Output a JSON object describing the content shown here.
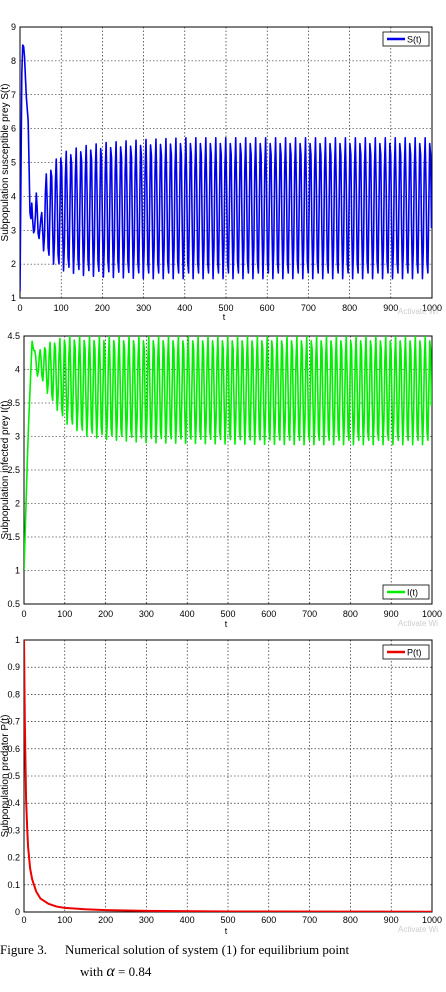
{
  "chart_data": [
    {
      "type": "line",
      "xlabel": "t",
      "ylabel": "Subpopulation susceptible prey S(t)",
      "xlim": [
        0,
        1000
      ],
      "ylim": [
        1,
        9
      ],
      "xticks": [
        0,
        100,
        200,
        300,
        400,
        500,
        600,
        700,
        800,
        900,
        1000
      ],
      "yticks": [
        1,
        2,
        3,
        4,
        5,
        6,
        7,
        8,
        9
      ],
      "grid": true,
      "legend_position": "top-right",
      "color": "#0000ee",
      "series": [
        {
          "name": "S(t)",
          "x": [
            0,
            5,
            10,
            15,
            20,
            25,
            30,
            35,
            40,
            50,
            60,
            80,
            100,
            150,
            200,
            300,
            400,
            500,
            700,
            1000
          ],
          "y": [
            1.2,
            8.5,
            8.4,
            7.0,
            6.2,
            3.0,
            4.3,
            3.0,
            4.2,
            3.3,
            4.6,
            5.0,
            5.3,
            5.5,
            5.6,
            5.7,
            5.75,
            5.75,
            5.75,
            5.75
          ],
          "y_low": [
            1.2,
            8.5,
            8.4,
            7.0,
            6.2,
            3.0,
            2.8,
            3.0,
            2.9,
            2.6,
            2.3,
            2.0,
            1.8,
            1.65,
            1.6,
            1.55,
            1.55,
            1.55,
            1.55,
            1.55
          ]
        }
      ]
    },
    {
      "type": "line",
      "xlabel": "t",
      "ylabel": "Subpopulation infected prey I(t)",
      "xlim": [
        0,
        1000
      ],
      "ylim": [
        0.5,
        4.5
      ],
      "xticks": [
        0,
        100,
        200,
        300,
        400,
        500,
        600,
        700,
        800,
        900,
        1000
      ],
      "yticks": [
        0.5,
        1,
        1.5,
        2,
        2.5,
        3,
        3.5,
        4,
        4.5
      ],
      "grid": true,
      "legend_position": "bottom-right",
      "color": "#00ee00",
      "series": [
        {
          "name": "I(t)",
          "x": [
            0,
            5,
            10,
            20,
            30,
            40,
            60,
            80,
            100,
            150,
            200,
            300,
            500,
            700,
            1000
          ],
          "y": [
            1.0,
            2.0,
            3.0,
            4.45,
            4.2,
            4.3,
            4.4,
            4.45,
            4.5,
            4.5,
            4.5,
            4.5,
            4.5,
            4.5,
            4.5
          ],
          "y_low": [
            1.0,
            2.0,
            3.0,
            4.45,
            3.9,
            3.9,
            3.6,
            3.4,
            3.2,
            3.0,
            2.95,
            2.9,
            2.88,
            2.87,
            2.87
          ]
        }
      ]
    },
    {
      "type": "line",
      "xlabel": "t",
      "ylabel": "Subpopulation predator P(t)",
      "xlim": [
        0,
        1000
      ],
      "ylim": [
        0,
        1
      ],
      "xticks": [
        0,
        100,
        200,
        300,
        400,
        500,
        600,
        700,
        800,
        900,
        1000
      ],
      "yticks": [
        0,
        0.1,
        0.2,
        0.3,
        0.4,
        0.5,
        0.6,
        0.7,
        0.8,
        0.9,
        1
      ],
      "ytick_labels": [
        "0",
        "0.1",
        "0.2",
        "0.3",
        "0.4",
        "0.5",
        "0.6",
        "0.7",
        "0.8",
        "0.9",
        "1"
      ],
      "grid": true,
      "legend_position": "top-right",
      "color": "#ee0000",
      "series": [
        {
          "name": "P(t)",
          "x": [
            0,
            2,
            5,
            8,
            10,
            15,
            20,
            30,
            40,
            60,
            80,
            100,
            150,
            200,
            300,
            500,
            1000
          ],
          "y": [
            1.0,
            0.7,
            0.42,
            0.3,
            0.24,
            0.16,
            0.12,
            0.075,
            0.05,
            0.03,
            0.02,
            0.015,
            0.01,
            0.007,
            0.004,
            0.002,
            0.001
          ]
        }
      ]
    }
  ],
  "watermark": "Activate Wi",
  "caption": {
    "label": "Figure 3.",
    "text": "Numerical solution of system (1) for equilibrium point",
    "line2_prefix": "with",
    "alpha_symbol": "α",
    "alpha_suffix": "= 0.84"
  }
}
